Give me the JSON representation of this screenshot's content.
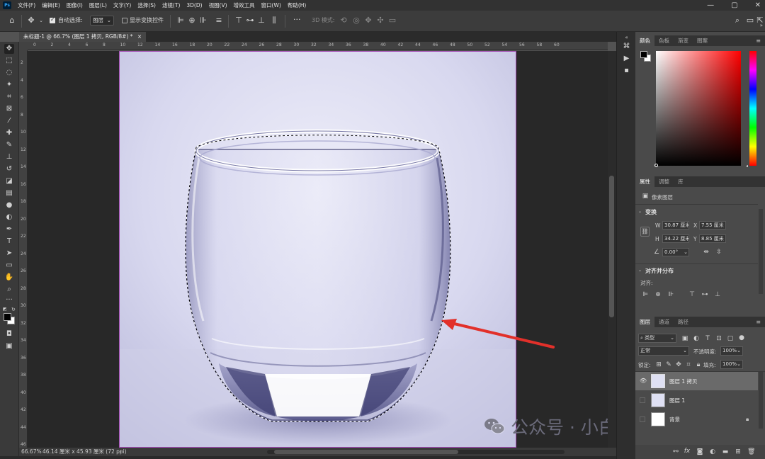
{
  "app": {
    "logo": "Ps",
    "menus": [
      "文件(F)",
      "编辑(E)",
      "图像(I)",
      "图层(L)",
      "文字(Y)",
      "选择(S)",
      "滤镜(T)",
      "3D(D)",
      "视图(V)",
      "增效工具",
      "窗口(W)",
      "帮助(H)"
    ],
    "window_controls": [
      "—",
      "▢",
      "✕"
    ]
  },
  "options_bar": {
    "auto_select_label": "自动选择:",
    "auto_select_checked": true,
    "auto_select_target": "图层",
    "show_transform_label": "显示变换控件",
    "show_transform_checked": false,
    "mode_3d_label": "3D 模式:",
    "more": "···"
  },
  "document": {
    "tab_title": "未标题-1 @ 66.7% (图层 1 拷贝, RGB/8#) *",
    "tab_close": "×"
  },
  "ruler": {
    "top_ticks": [
      "0",
      "2",
      "4",
      "6",
      "8",
      "10",
      "12",
      "14",
      "16",
      "18",
      "20",
      "22",
      "24",
      "26",
      "28",
      "30",
      "32",
      "34",
      "36",
      "38",
      "40",
      "42",
      "44",
      "46",
      "48",
      "50",
      "52",
      "54",
      "56",
      "58",
      "60"
    ],
    "left_ticks": [
      "2",
      "4",
      "6",
      "8",
      "10",
      "12",
      "14",
      "16",
      "18",
      "20",
      "22",
      "24",
      "26",
      "28",
      "30",
      "32",
      "34",
      "36",
      "38",
      "40",
      "42",
      "44",
      "46"
    ]
  },
  "status": {
    "zoom": "66.67%",
    "doc_info": "46.14 厘米 x 45.93 厘米 (72 ppi)",
    "arrow": "›"
  },
  "color_panel": {
    "tabs": [
      "颜色",
      "色板",
      "渐变",
      "图案"
    ],
    "active_tab": 0,
    "foreground": "#000000",
    "background": "#ffffff",
    "hue": "#ff0000"
  },
  "properties_panel": {
    "tabs": [
      "属性",
      "调整",
      "库"
    ],
    "active_tab": 0,
    "layer_kind": "像素图层",
    "transform_title": "变换",
    "w_label": "W",
    "w_value": "30.87 厘米",
    "x_label": "X",
    "x_value": "7.55 厘米",
    "h_label": "H",
    "h_value": "34.22 厘米",
    "y_label": "Y",
    "y_value": "8.85 厘米",
    "angle_value": "0.00°",
    "align_title": "对齐并分布",
    "align_label": "对齐:"
  },
  "layers_panel": {
    "tabs": [
      "图层",
      "通道",
      "路径"
    ],
    "active_tab": 0,
    "filter_kind": "类型",
    "blend_mode": "正常",
    "opacity_label": "不透明度:",
    "opacity_value": "100%",
    "lock_label": "锁定:",
    "fill_label": "填充:",
    "fill_value": "100%",
    "layers": [
      {
        "name": "图层 1 拷贝",
        "visible": true,
        "selected": true
      },
      {
        "name": "图层 1",
        "visible": false,
        "selected": false
      },
      {
        "name": "背景",
        "visible": false,
        "selected": false,
        "locked": true
      }
    ],
    "footer_icons": [
      "link-icon",
      "fx-icon",
      "mask-icon",
      "adjustment-icon",
      "group-icon",
      "new-layer-icon",
      "delete-icon"
    ],
    "fx_label": "fx"
  },
  "watermark": {
    "text": "公众号 · 小白电脑技术"
  },
  "accent_colors": {
    "selection_border": "#a34bb3",
    "arrow": "#e2302a"
  }
}
